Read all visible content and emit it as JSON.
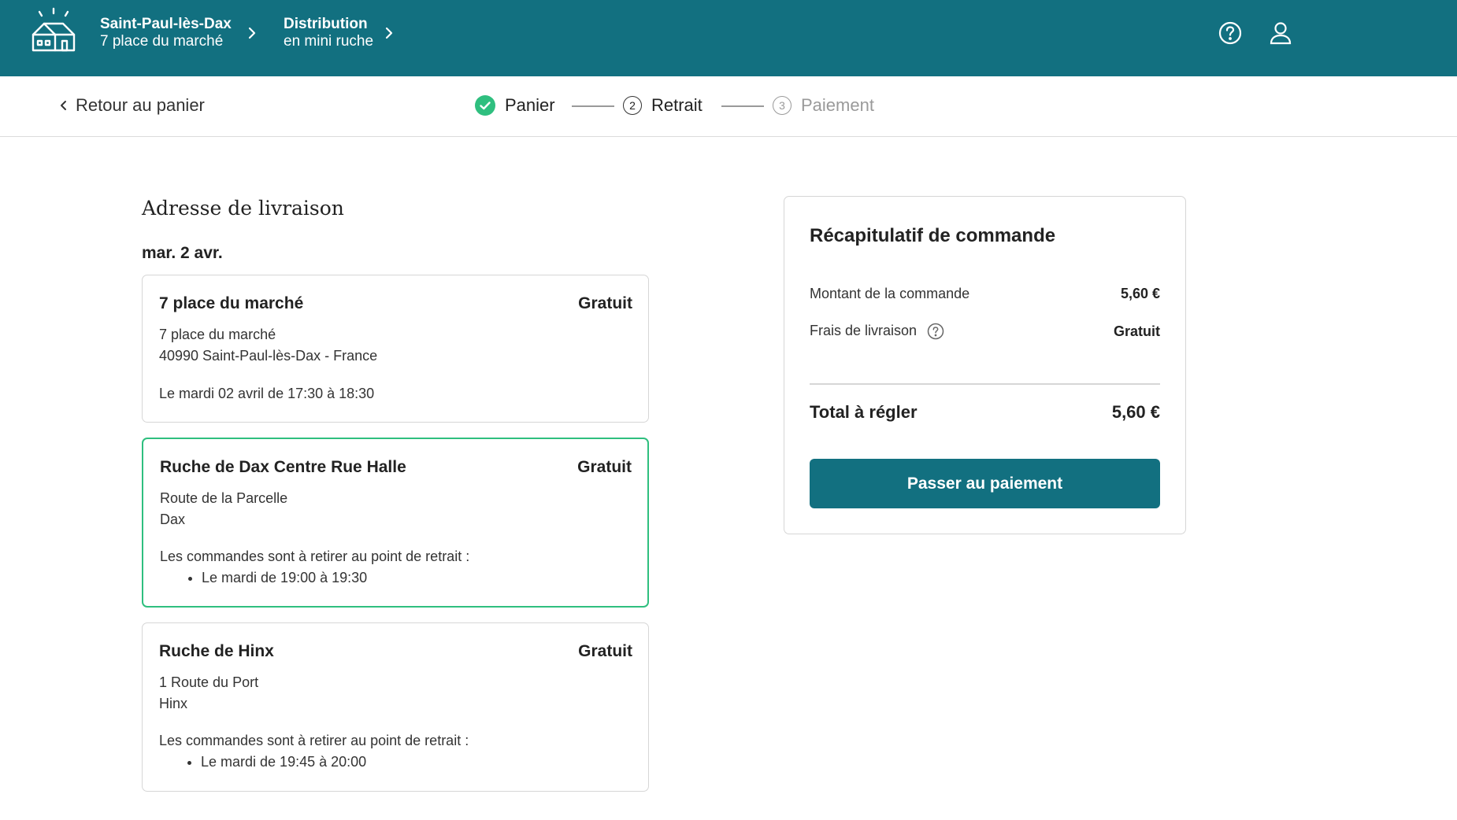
{
  "header": {
    "location": {
      "name": "Saint-Paul-lès-Dax",
      "address": "7 place du marché"
    },
    "distribution": {
      "title": "Distribution",
      "mode": "en mini ruche"
    },
    "icons": [
      "house-logo-icon",
      "help-icon",
      "user-icon"
    ]
  },
  "steps_bar": {
    "back_label": "Retour au panier",
    "steps": [
      {
        "label": "Panier",
        "number": "1",
        "status": "done"
      },
      {
        "label": "Retrait",
        "number": "2",
        "status": "current"
      },
      {
        "label": "Paiement",
        "number": "3",
        "status": "upcoming"
      }
    ]
  },
  "delivery": {
    "section_title": "Adresse de livraison",
    "date": "mar. 2 avr.",
    "options": [
      {
        "name": "7 place du marché",
        "price": "Gratuit",
        "address_line1": "7 place du marché",
        "address_line2": "40990 Saint-Paul-lès-Dax - France",
        "schedule": "Le mardi 02 avril de 17:30 à 18:30",
        "selected": false
      },
      {
        "name": "Ruche de Dax Centre Rue Halle",
        "price": "Gratuit",
        "address_line1": "Route de la Parcelle",
        "address_line2": "Dax",
        "info": "Les commandes sont à retirer au point de retrait :",
        "slot": "Le mardi de 19:00 à 19:30",
        "selected": true
      },
      {
        "name": "Ruche de Hinx",
        "price": "Gratuit",
        "address_line1": "1 Route du Port",
        "address_line2": "Hinx",
        "info": "Les commandes sont à retirer au point de retrait :",
        "slot": "Le mardi de 19:45 à 20:00",
        "selected": false
      }
    ]
  },
  "summary": {
    "title": "Récapitulatif de commande",
    "order_amount_label": "Montant de la commande",
    "order_amount_value": "5,60 €",
    "delivery_fee_label": "Frais de livraison",
    "delivery_fee_value": "Gratuit",
    "total_label": "Total à régler",
    "total_value": "5,60 €",
    "pay_button": "Passer au paiement"
  },
  "colors": {
    "brand": "#127080",
    "success": "#2fbf7f",
    "muted": "#9a9a9a"
  }
}
